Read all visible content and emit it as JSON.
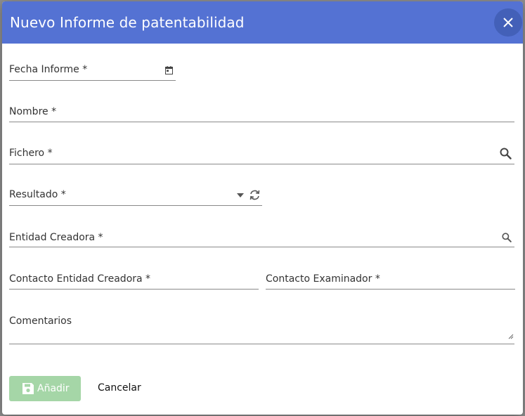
{
  "dialog": {
    "title": "Nuevo Informe de patentabilidad",
    "close_icon": "close-icon"
  },
  "form": {
    "fecha_informe": {
      "label": "Fecha Informe *",
      "icon": "calendar-icon"
    },
    "nombre": {
      "label": "Nombre *"
    },
    "fichero": {
      "label": "Fichero *",
      "icon": "search-icon"
    },
    "resultado": {
      "label": "Resultado *",
      "icons": [
        "dropdown-arrow-icon",
        "refresh-icon"
      ]
    },
    "entidad_creadora": {
      "label": "Entidad Creadora *",
      "icon": "search-icon"
    },
    "contacto_entidad_creadora": {
      "label": "Contacto Entidad Creadora *"
    },
    "contacto_examinador": {
      "label": "Contacto Examinador *"
    },
    "comentarios": {
      "label": "Comentarios"
    }
  },
  "actions": {
    "add_label": "Añadir",
    "add_icon": "save-icon",
    "cancel_label": "Cancelar"
  },
  "colors": {
    "header": "#5472d3",
    "close_button": "#4360b8",
    "add_button_disabled": "#a5d6a7"
  }
}
